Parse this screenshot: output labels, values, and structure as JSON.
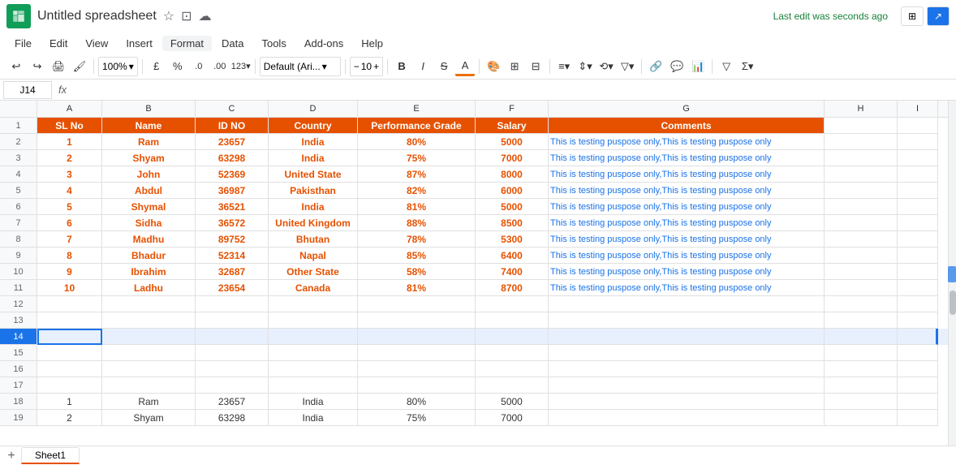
{
  "titleBar": {
    "title": "Untitled spreadsheet",
    "lastEdit": "Last edit was seconds ago",
    "icons": [
      "★",
      "⊡",
      "☁"
    ]
  },
  "menuBar": {
    "items": [
      "File",
      "Edit",
      "View",
      "Insert",
      "Format",
      "Data",
      "Tools",
      "Add-ons",
      "Help"
    ]
  },
  "toolbar": {
    "zoom": "100%",
    "currency": "£",
    "percent": "%",
    "decimal0": ".0",
    "decimal00": ".00",
    "format123": "123▾",
    "font": "Default (Ari...",
    "fontSize": "10",
    "bold": "B",
    "italic": "I",
    "strikethrough": "S",
    "underlineA": "A"
  },
  "formulaBar": {
    "cellRef": "J14",
    "fx": "fx"
  },
  "columns": [
    "A",
    "B",
    "C",
    "D",
    "E",
    "F",
    "G",
    "H",
    "I"
  ],
  "headers": {
    "slNo": "SL No",
    "name": "Name",
    "idNo": "ID NO",
    "country": "Country",
    "performanceGrade": "Performance Grade",
    "salary": "Salary",
    "comments": "Comments"
  },
  "rows": [
    {
      "sl": "1",
      "name": "Ram",
      "id": "23657",
      "country": "India",
      "perf": "80%",
      "salary": "5000",
      "comment": "This is testing puspose only,This is testing puspose only"
    },
    {
      "sl": "2",
      "name": "Shyam",
      "id": "63298",
      "country": "India",
      "perf": "75%",
      "salary": "7000",
      "comment": "This is testing puspose only,This is testing puspose only"
    },
    {
      "sl": "3",
      "name": "John",
      "id": "52369",
      "country": "United State",
      "perf": "87%",
      "salary": "8000",
      "comment": "This is testing puspose only,This is testing puspose only"
    },
    {
      "sl": "4",
      "name": "Abdul",
      "id": "36987",
      "country": "Pakisthan",
      "perf": "82%",
      "salary": "6000",
      "comment": "This is testing puspose only,This is testing puspose only"
    },
    {
      "sl": "5",
      "name": "Shymal",
      "id": "36521",
      "country": "India",
      "perf": "81%",
      "salary": "5000",
      "comment": "This is testing puspose only,This is testing puspose only"
    },
    {
      "sl": "6",
      "name": "Sidha",
      "id": "36572",
      "country": "United Kingdom",
      "perf": "88%",
      "salary": "8500",
      "comment": "This is testing puspose only,This is testing puspose only"
    },
    {
      "sl": "7",
      "name": "Madhu",
      "id": "89752",
      "country": "Bhutan",
      "perf": "78%",
      "salary": "5300",
      "comment": "This is testing puspose only,This is testing puspose only"
    },
    {
      "sl": "8",
      "name": "Bhadur",
      "id": "52314",
      "country": "Napal",
      "perf": "85%",
      "salary": "6400",
      "comment": "This is testing puspose only,This is testing puspose only"
    },
    {
      "sl": "9",
      "name": "Ibrahim",
      "id": "32687",
      "country": "Other State",
      "perf": "58%",
      "salary": "7400",
      "comment": "This is testing puspose only,This is testing puspose only"
    },
    {
      "sl": "10",
      "name": "Ladhu",
      "id": "23654",
      "country": "Canada",
      "perf": "81%",
      "salary": "8700",
      "comment": "This is testing puspose only,This is testing puspose only"
    }
  ],
  "bottomRows": [
    {
      "sl": "1",
      "name": "Ram",
      "id": "23657",
      "country": "India",
      "perf": "80%",
      "salary": "5000"
    },
    {
      "sl": "2",
      "name": "Shyam",
      "id": "63298",
      "country": "India",
      "perf": "75%",
      "salary": "7000"
    }
  ],
  "sheetTabs": [
    "Sheet1"
  ]
}
